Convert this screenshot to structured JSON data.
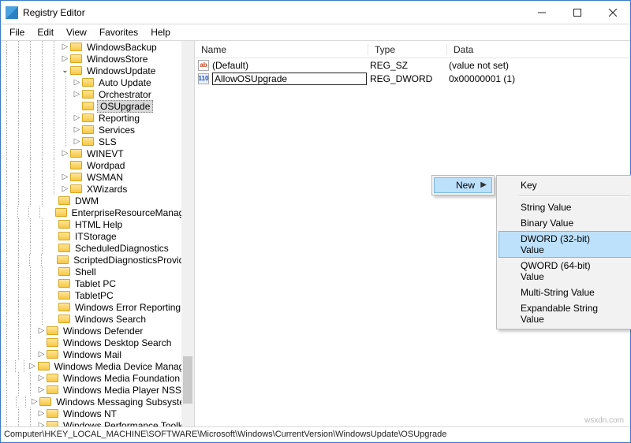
{
  "window": {
    "title": "Registry Editor"
  },
  "menu": {
    "file": "File",
    "edit": "Edit",
    "view": "View",
    "favorites": "Favorites",
    "help": "Help"
  },
  "tree": {
    "items": [
      "WindowsBackup",
      "WindowsStore",
      "WindowsUpdate",
      "Auto Update",
      "Orchestrator",
      "OSUpgrade",
      "Reporting",
      "Services",
      "SLS",
      "WINEVT",
      "Wordpad",
      "WSMAN",
      "XWizards",
      "DWM",
      "EnterpriseResourceManager",
      "HTML Help",
      "ITStorage",
      "ScheduledDiagnostics",
      "ScriptedDiagnosticsProvider",
      "Shell",
      "Tablet PC",
      "TabletPC",
      "Windows Error Reporting",
      "Windows Search",
      "Windows Defender",
      "Windows Desktop Search",
      "Windows Mail",
      "Windows Media Device Manager",
      "Windows Media Foundation",
      "Windows Media Player NSS",
      "Windows Messaging Subsystem",
      "Windows NT",
      "Windows Performance Toolkit"
    ]
  },
  "columns": {
    "name": "Name",
    "type": "Type",
    "data": "Data"
  },
  "values": [
    {
      "name": "(Default)",
      "type": "REG_SZ",
      "data": "(value not set)",
      "icon": "sz"
    },
    {
      "name": "AllowOSUpgrade",
      "type": "REG_DWORD",
      "data": "0x00000001 (1)",
      "icon": "dw",
      "editing": true
    }
  ],
  "context": {
    "new": "New",
    "sub": {
      "key": "Key",
      "string": "String Value",
      "binary": "Binary Value",
      "dword": "DWORD (32-bit) Value",
      "qword": "QWORD (64-bit) Value",
      "multi": "Multi-String Value",
      "expand": "Expandable String Value"
    }
  },
  "status": "Computer\\HKEY_LOCAL_MACHINE\\SOFTWARE\\Microsoft\\Windows\\CurrentVersion\\WindowsUpdate\\OSUpgrade",
  "watermark": "wsxdn.com"
}
